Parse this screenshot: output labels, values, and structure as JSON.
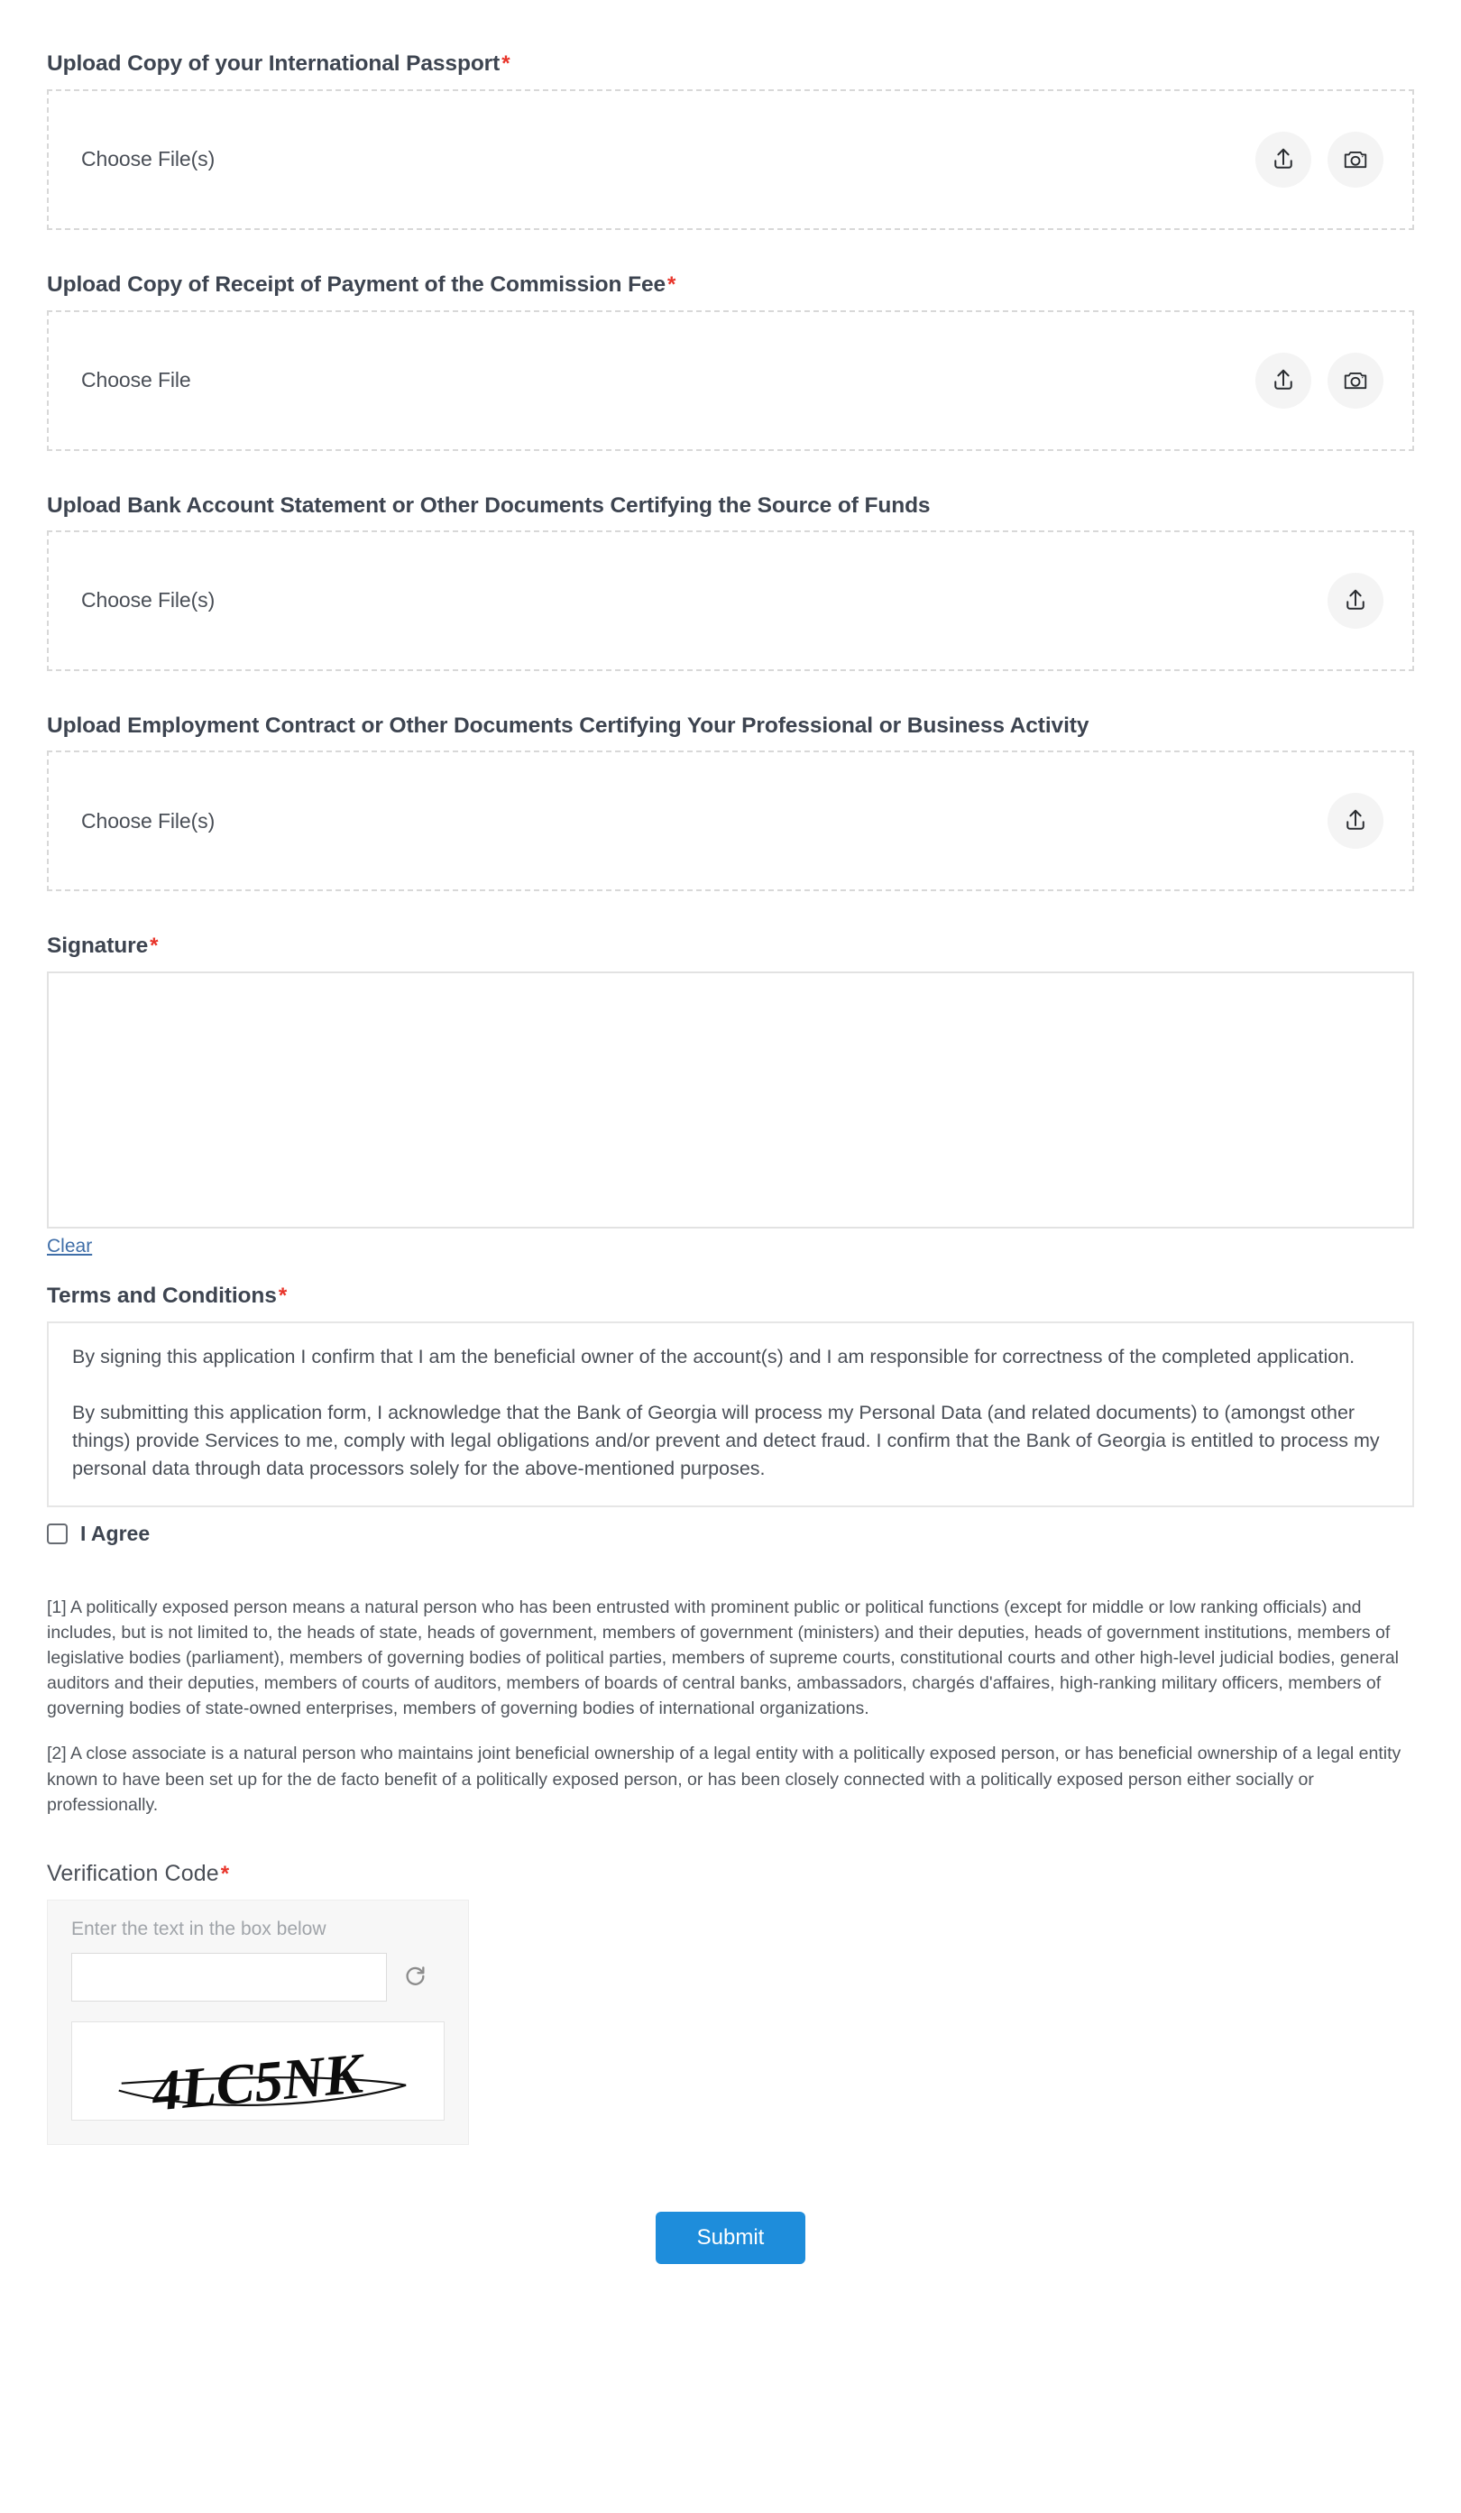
{
  "uploads": [
    {
      "label": "Upload Copy of your International Passport",
      "required": true,
      "placeholder": "Choose File(s)",
      "has_camera": true
    },
    {
      "label": "Upload Copy of Receipt of Payment of the Commission Fee",
      "required": true,
      "placeholder": "Choose File",
      "has_camera": true
    },
    {
      "label": "Upload Bank Account Statement or Other Documents Certifying the Source of Funds",
      "required": false,
      "placeholder": "Choose File(s)",
      "has_camera": false
    },
    {
      "label": "Upload Employment Contract or Other Documents Certifying Your Professional or Business Activity",
      "required": false,
      "placeholder": "Choose File(s)",
      "has_camera": false
    }
  ],
  "signature": {
    "label": "Signature",
    "required_mark": "*",
    "clear_label": "Clear",
    "value": ""
  },
  "terms": {
    "label": "Terms and Conditions",
    "required_mark": "*",
    "paragraph_1": "By signing this application I confirm that I am the beneficial owner of the account(s) and  I am responsible for correctness of the completed application.",
    "paragraph_2": "By submitting this application form, I acknowledge that the Bank of Georgia will process my Personal Data (and related documents) to (amongst other things) provide Services to me, comply with legal obligations and/or prevent and detect fraud. I confirm that the Bank of Georgia is entitled to process my personal data through data processors solely for the above-mentioned purposes.",
    "agree_label": "I Agree",
    "agree_checked": false
  },
  "footnotes": {
    "note_1": "[1] A politically exposed person means a natural person who has been entrusted with prominent public or political functions (except for middle or low ranking officials) and includes, but is not limited to, the heads of state, heads of government, members of government (ministers) and their deputies, heads of government institutions, members of legislative bodies (parliament), members of governing bodies of political parties, members of supreme courts, constitutional courts and other high-level judicial bodies, general auditors and their deputies, members of courts of auditors, members of boards of central banks, ambassadors, chargés d'affaires, high-ranking military officers, members of governing bodies of state-owned enterprises, members of governing bodies of international organizations.",
    "note_2": "[2] A close associate is a natural person who maintains joint beneficial ownership of a legal entity with a politically exposed person, or has beneficial ownership of a legal entity known to have been set up for the de facto benefit of a politically exposed person, or has been closely connected with a politically exposed person either socially or professionally."
  },
  "captcha": {
    "label": "Verification Code",
    "required_mark": "*",
    "hint": "Enter the text in the box below",
    "input_value": "",
    "code_text": "4LC5NK",
    "refresh_icon": "refresh-icon"
  },
  "submit": {
    "label": "Submit"
  },
  "colors": {
    "required_asterisk": "#e8342a",
    "link": "#3f6ea8",
    "submit_background": "#1e8ddb",
    "dashed_border": "#d8d8d8"
  },
  "icons": {
    "upload": "upload-icon",
    "camera": "camera-icon",
    "refresh": "refresh-icon"
  }
}
